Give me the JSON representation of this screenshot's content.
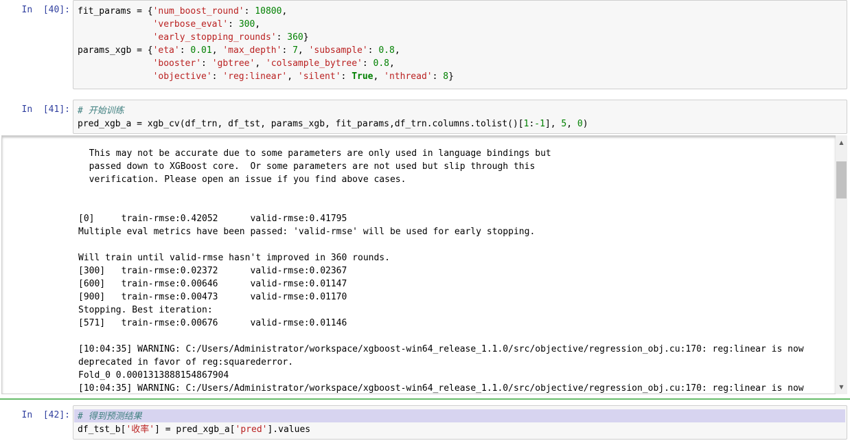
{
  "cells": [
    {
      "prompt": "In  [40]:",
      "lines": [
        [
          {
            "t": "fit_params = {",
            "c": ""
          },
          {
            "t": "'num_boost_round'",
            "c": "str"
          },
          {
            "t": ": ",
            "c": ""
          },
          {
            "t": "10800",
            "c": "num"
          },
          {
            "t": ",",
            "c": ""
          }
        ],
        [
          {
            "t": "              ",
            "c": ""
          },
          {
            "t": "'verbose_eval'",
            "c": "str"
          },
          {
            "t": ": ",
            "c": ""
          },
          {
            "t": "300",
            "c": "num"
          },
          {
            "t": ",",
            "c": ""
          }
        ],
        [
          {
            "t": "              ",
            "c": ""
          },
          {
            "t": "'early_stopping_rounds'",
            "c": "str"
          },
          {
            "t": ": ",
            "c": ""
          },
          {
            "t": "360",
            "c": "num"
          },
          {
            "t": "}",
            "c": ""
          }
        ],
        [
          {
            "t": "params_xgb = {",
            "c": ""
          },
          {
            "t": "'eta'",
            "c": "str"
          },
          {
            "t": ": ",
            "c": ""
          },
          {
            "t": "0.01",
            "c": "num"
          },
          {
            "t": ", ",
            "c": ""
          },
          {
            "t": "'max_depth'",
            "c": "str"
          },
          {
            "t": ": ",
            "c": ""
          },
          {
            "t": "7",
            "c": "num"
          },
          {
            "t": ", ",
            "c": ""
          },
          {
            "t": "'subsample'",
            "c": "str"
          },
          {
            "t": ": ",
            "c": ""
          },
          {
            "t": "0.8",
            "c": "num"
          },
          {
            "t": ",",
            "c": ""
          }
        ],
        [
          {
            "t": "              ",
            "c": ""
          },
          {
            "t": "'booster'",
            "c": "str"
          },
          {
            "t": ": ",
            "c": ""
          },
          {
            "t": "'gbtree'",
            "c": "str"
          },
          {
            "t": ", ",
            "c": ""
          },
          {
            "t": "'colsample_bytree'",
            "c": "str"
          },
          {
            "t": ": ",
            "c": ""
          },
          {
            "t": "0.8",
            "c": "num"
          },
          {
            "t": ",",
            "c": ""
          }
        ],
        [
          {
            "t": "              ",
            "c": ""
          },
          {
            "t": "'objective'",
            "c": "str"
          },
          {
            "t": ": ",
            "c": ""
          },
          {
            "t": "'reg:linear'",
            "c": "str"
          },
          {
            "t": ", ",
            "c": ""
          },
          {
            "t": "'silent'",
            "c": "str"
          },
          {
            "t": ": ",
            "c": ""
          },
          {
            "t": "True",
            "c": "kw"
          },
          {
            "t": ", ",
            "c": ""
          },
          {
            "t": "'nthread'",
            "c": "str"
          },
          {
            "t": ": ",
            "c": ""
          },
          {
            "t": "8",
            "c": "num"
          },
          {
            "t": "}",
            "c": ""
          }
        ]
      ]
    },
    {
      "prompt": "In  [41]:",
      "lines": [
        [
          {
            "t": "# 开始训练",
            "c": "cmt"
          }
        ],
        [
          {
            "t": "pred_xgb_a = xgb_cv(df_trn, df_tst, params_xgb, fit_params,df_trn.columns.tolist()[",
            "c": ""
          },
          {
            "t": "1",
            "c": "num"
          },
          {
            "t": ":",
            "c": ""
          },
          {
            "t": "-1",
            "c": "num"
          },
          {
            "t": "], ",
            "c": ""
          },
          {
            "t": "5",
            "c": "num"
          },
          {
            "t": ", ",
            "c": ""
          },
          {
            "t": "0",
            "c": "num"
          },
          {
            "t": ")",
            "c": ""
          }
        ]
      ]
    },
    {
      "prompt": "In  [42]:",
      "lines": [
        [
          {
            "t": "# 得到预测结果",
            "c": "cmt"
          }
        ],
        [
          {
            "t": "df_tst_b[",
            "c": ""
          },
          {
            "t": "'收率'",
            "c": "str"
          },
          {
            "t": "] = pred_xgb_a[",
            "c": ""
          },
          {
            "t": "'pred'",
            "c": "str"
          },
          {
            "t": "].values",
            "c": ""
          }
        ]
      ]
    }
  ],
  "output_lines": [
    "  This may not be accurate due to some parameters are only used in language bindings but",
    "  passed down to XGBoost core.  Or some parameters are not used but slip through this",
    "  verification. Please open an issue if you find above cases.",
    "",
    "",
    "[0]\ttrain-rmse:0.42052\tvalid-rmse:0.41795",
    "Multiple eval metrics have been passed: 'valid-rmse' will be used for early stopping.",
    "",
    "Will train until valid-rmse hasn't improved in 360 rounds.",
    "[300]\ttrain-rmse:0.02372\tvalid-rmse:0.02367",
    "[600]\ttrain-rmse:0.00646\tvalid-rmse:0.01147",
    "[900]\ttrain-rmse:0.00473\tvalid-rmse:0.01170",
    "Stopping. Best iteration:",
    "[571]\ttrain-rmse:0.00676\tvalid-rmse:0.01146",
    "",
    "[10:04:35] WARNING: C:/Users/Administrator/workspace/xgboost-win64_release_1.1.0/src/objective/regression_obj.cu:170: reg:linear is now",
    "deprecated in favor of reg:squarederror.",
    "Fold_0 0.0001313888154867904",
    "[10:04:35] WARNING: C:/Users/Administrator/workspace/xgboost-win64_release_1.1.0/src/objective/regression_obj.cu:170: reg:linear is now"
  ],
  "scrollbar": {
    "up_icon": "▲",
    "down_icon": "▼"
  },
  "colors": {
    "prompt": "#303f9f",
    "string": "#ba2121",
    "number": "#008000",
    "comment": "#408080",
    "selected_bar": "#66bb6a"
  }
}
